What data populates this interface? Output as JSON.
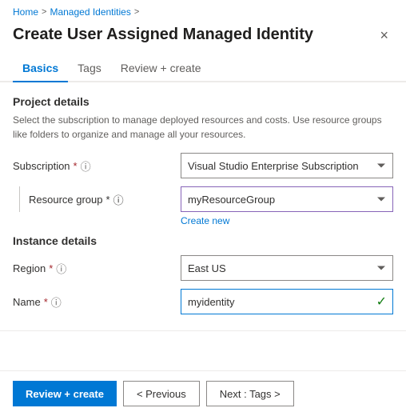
{
  "breadcrumb": {
    "home": "Home",
    "managed_identities": "Managed Identities",
    "sep1": ">",
    "sep2": ">"
  },
  "header": {
    "title": "Create User Assigned Managed Identity",
    "close_label": "×"
  },
  "tabs": [
    {
      "id": "basics",
      "label": "Basics",
      "active": true
    },
    {
      "id": "tags",
      "label": "Tags",
      "active": false
    },
    {
      "id": "review",
      "label": "Review + create",
      "active": false
    }
  ],
  "project_details": {
    "title": "Project details",
    "description": "Select the subscription to manage deployed resources and costs. Use resource groups like folders to organize and manage all your resources."
  },
  "fields": {
    "subscription": {
      "label": "Subscription",
      "required": "*",
      "value": "Visual Studio Enterprise Subscription"
    },
    "resource_group": {
      "label": "Resource group",
      "required": "*",
      "value": "myResourceGroup",
      "create_new": "Create new"
    }
  },
  "instance_details": {
    "title": "Instance details"
  },
  "instance_fields": {
    "region": {
      "label": "Region",
      "required": "*",
      "value": "East US"
    },
    "name": {
      "label": "Name",
      "required": "*",
      "value": "myidentity"
    }
  },
  "footer": {
    "review_create": "Review + create",
    "previous": "< Previous",
    "next": "Next : Tags >"
  },
  "icons": {
    "info": "ⓘ",
    "check": "✓",
    "close": "✕"
  }
}
